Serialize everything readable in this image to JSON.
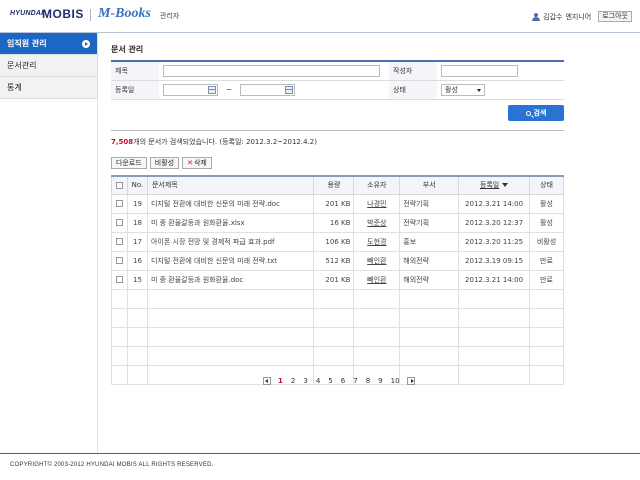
{
  "header": {
    "brand_hyundai": "HYUNDAI",
    "brand_mobis": "MOBIS",
    "app_title": "M-Books",
    "admin_label": "관리자",
    "user_name": "김갑수",
    "user_role": "엔지니어",
    "logout_label": "로그아웃"
  },
  "sidebar": {
    "items": [
      {
        "label": "임직원 관리",
        "active": true
      },
      {
        "label": "문서관리",
        "active": false
      },
      {
        "label": "통계",
        "active": false
      }
    ]
  },
  "page": {
    "title": "문서 관리"
  },
  "search": {
    "title_label": "제목",
    "author_label": "작성자",
    "date_label": "등록일",
    "date_sep": "~",
    "status_label": "상태",
    "status_value": "활성",
    "button_label": "검색"
  },
  "result": {
    "count": "7,508",
    "text": "개의 문서가 검색되었습니다.",
    "range": "(등록일: 2012.3.2~2012.4.2)"
  },
  "actions": {
    "download": "다운로드",
    "deactivate": "비활성",
    "delete": "삭제"
  },
  "table": {
    "columns": [
      "No.",
      "문서제목",
      "용량",
      "소유자",
      "부서",
      "등록일",
      "상태"
    ],
    "rows": [
      {
        "no": "19",
        "title": "디지털 전환에 대비한 신문의 미래 전략.doc",
        "size": "201 KB",
        "owner": "나경민",
        "dept": "전략기획",
        "date": "2012.3.21 14:00",
        "status": "활성"
      },
      {
        "no": "18",
        "title": "미 중 환율갈등과 원화환율.xlsx",
        "size": "16 KB",
        "owner": "박준상",
        "dept": "전략기획",
        "date": "2012.3.20 12:37",
        "status": "활성"
      },
      {
        "no": "17",
        "title": "아이폰 시장 전망 및 경제적 파급 효과.pdf",
        "size": "106 KB",
        "owner": "도현경",
        "dept": "홍보",
        "date": "2012.3.20 11:25",
        "status": "비활성"
      },
      {
        "no": "16",
        "title": "디지털 전환에 대비한 신문의 미래 전략.txt",
        "size": "512 KB",
        "owner": "빼인환",
        "dept": "해외전략",
        "date": "2012.3.19 09:15",
        "status": "만료"
      },
      {
        "no": "15",
        "title": "미 중 환율갈등과 원화환율.doc",
        "size": "201 KB",
        "owner": "빼인환",
        "dept": "해외전략",
        "date": "2012.3.21 14:00",
        "status": "만료"
      }
    ]
  },
  "pagination": {
    "pages": [
      "1",
      "2",
      "3",
      "4",
      "5",
      "6",
      "7",
      "8",
      "9",
      "10"
    ],
    "current": "1"
  },
  "footer": {
    "copyright": "COPYRIGHT© 2003-2012 HYUNDAI MOBIS ALL RIGHTS RESERVED."
  }
}
